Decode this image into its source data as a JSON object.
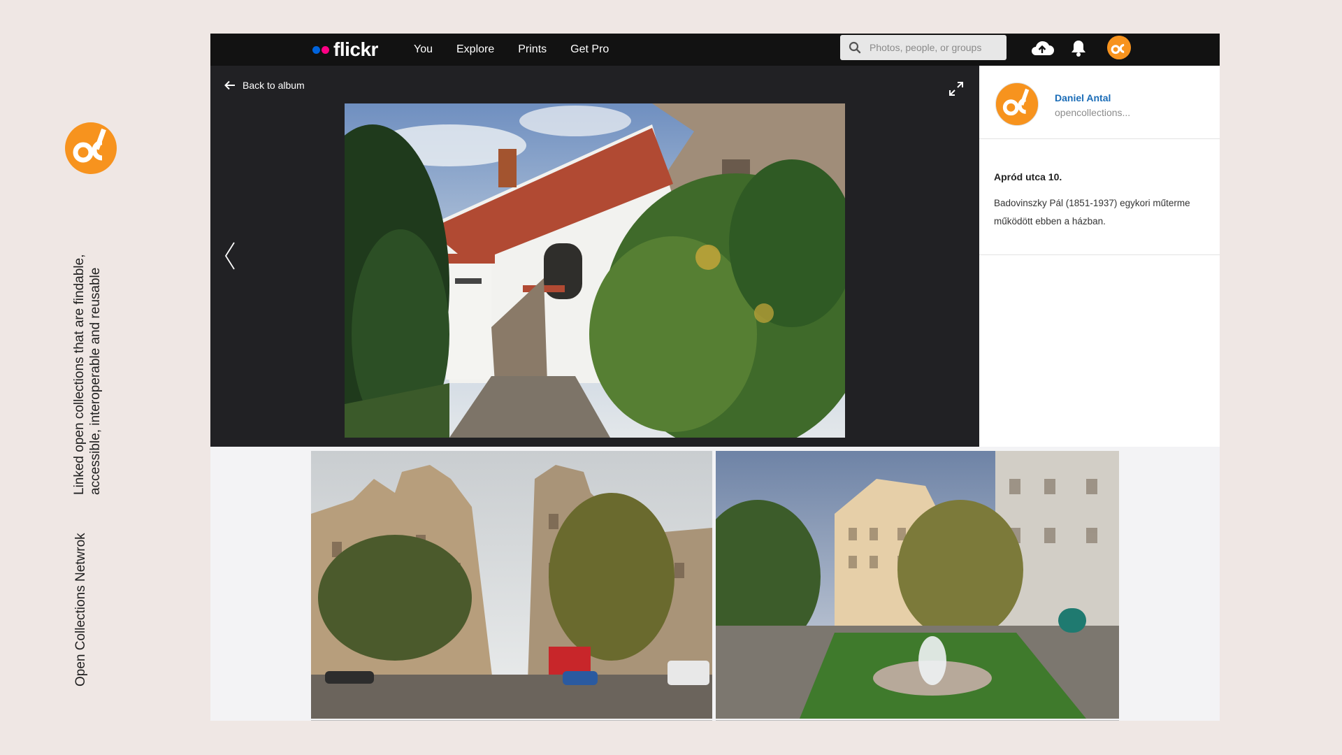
{
  "branding": {
    "tagline": "Linked open collections that are findable, accessible, interoperable and reusable",
    "network": "Open Collections Netwrok",
    "logo_icon": "oc-logo-icon",
    "logo_color": "#f7931e"
  },
  "topbar": {
    "brand": "flickr",
    "brand_colors": [
      "#0063dc",
      "#ff0084"
    ],
    "nav": [
      "You",
      "Explore",
      "Prints",
      "Get Pro"
    ],
    "search_placeholder": "Photos, people, or groups",
    "icons": [
      "upload-cloud-icon",
      "bell-icon",
      "avatar"
    ]
  },
  "viewer": {
    "back_label": "Back to album",
    "expand_icon": "expand-icon",
    "prev_icon": "chevron-left-icon"
  },
  "sidebar": {
    "owner_name": "Daniel Antal",
    "owner_handle": "opencollections...",
    "photo_title": "Apród utca 10.",
    "photo_description": "Badovinszky Pál (1851-1937) egykori műterme működött ebben a házban."
  },
  "colors": {
    "page_bg": "#efe7e4",
    "topbar_bg": "#121212",
    "stage_bg": "#212124",
    "link": "#1a6cb7"
  }
}
